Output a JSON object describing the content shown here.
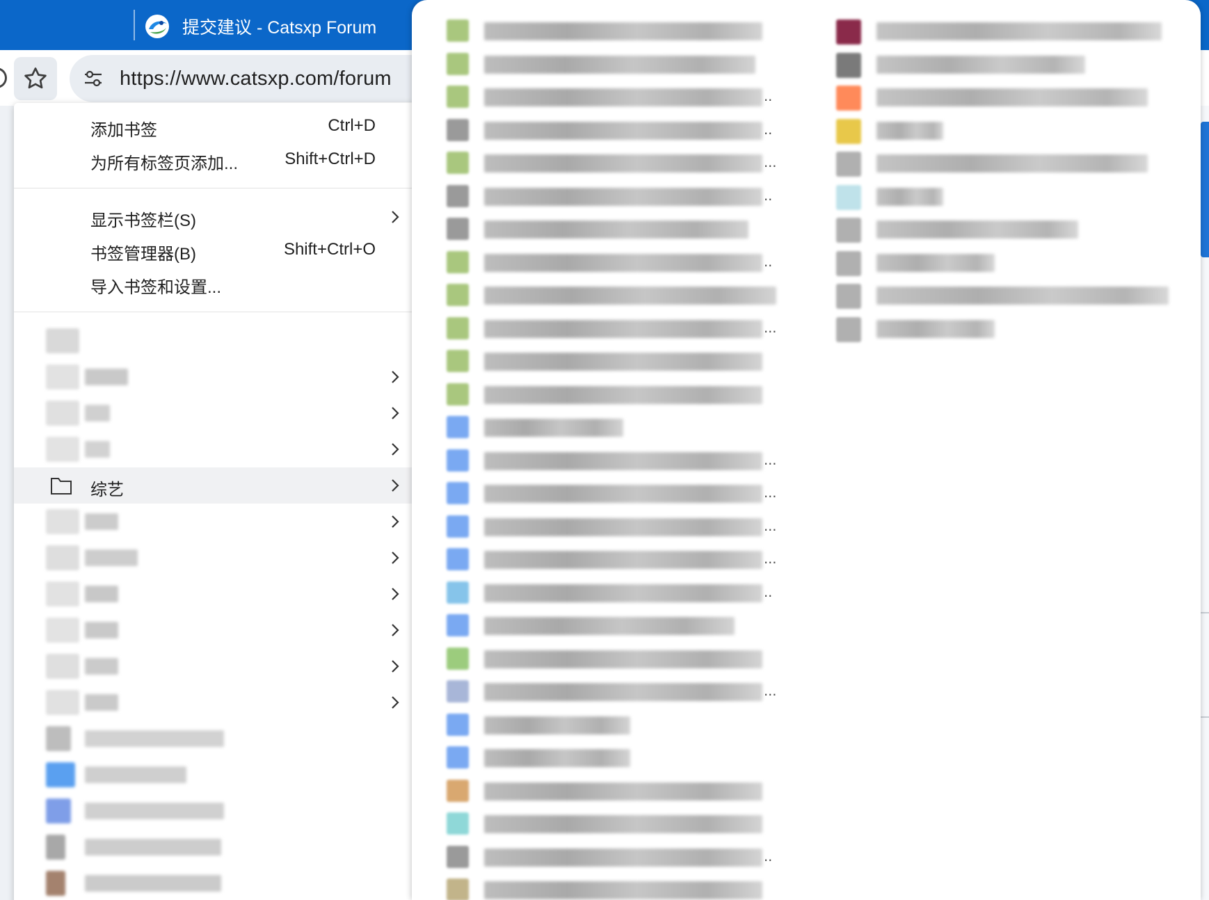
{
  "tab": {
    "title": "提交建议 - Catsxp Forum"
  },
  "omnibox": {
    "url": "https://www.catsxp.com/forum"
  },
  "menu": {
    "add_bookmark": {
      "label": "添加书签",
      "shortcut": "Ctrl+D"
    },
    "add_all_tabs": {
      "label": "为所有标签页添加...",
      "shortcut": "Shift+Ctrl+D"
    },
    "show_bar": {
      "label": "显示书签栏(S)"
    },
    "manager": {
      "label": "书签管理器(B)",
      "shortcut": "Shift+Ctrl+O"
    },
    "import": {
      "label": "导入书签和设置..."
    },
    "active_folder": {
      "label": "综艺"
    }
  },
  "submenu": {
    "ellipsis": "..",
    "ellipsis3": "..."
  },
  "colors": {
    "tabstrip": "#0b67c9",
    "accent": "#1f74d6"
  }
}
